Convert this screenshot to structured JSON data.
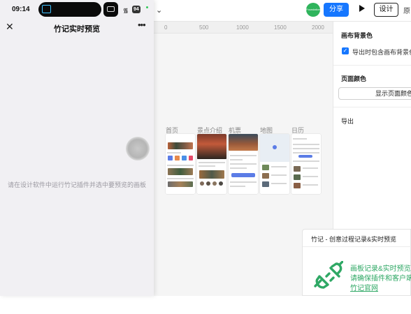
{
  "status_bar": {
    "time": "09:14",
    "battery": "94"
  },
  "preview_window": {
    "title": "竹记实时预览",
    "close_icon": "close-icon",
    "more_icon": "more-icon",
    "hint": "请在设计软件中运行竹记插件并选中要预览的画板"
  },
  "toolbar": {
    "avatar_text": "Foundation",
    "share_label": "分享",
    "design_label": "设计",
    "prototype_label": "原"
  },
  "ruler": {
    "ticks": [
      "0",
      "500",
      "1000",
      "1500",
      "2000"
    ]
  },
  "frames": [
    {
      "label": "首页"
    },
    {
      "label": "景点介绍"
    },
    {
      "label": "机票"
    },
    {
      "label": "地图"
    },
    {
      "label": "日历"
    }
  ],
  "right_panel": {
    "canvas_bg_title": "画布背景色",
    "export_include_bg": "导出时包含画布背景色",
    "page_color_title": "页面颜色",
    "show_page_color_btn": "显示页面颜色",
    "export_title": "导出"
  },
  "promo_card": {
    "title": "竹记 - 创意过程记录&实时预览",
    "line1": "画板记录&实时预览",
    "line2": "请确保插件和客户端",
    "link": "竹记官网"
  },
  "colors": {
    "accent": "#1677ff",
    "green": "#2fa865"
  }
}
